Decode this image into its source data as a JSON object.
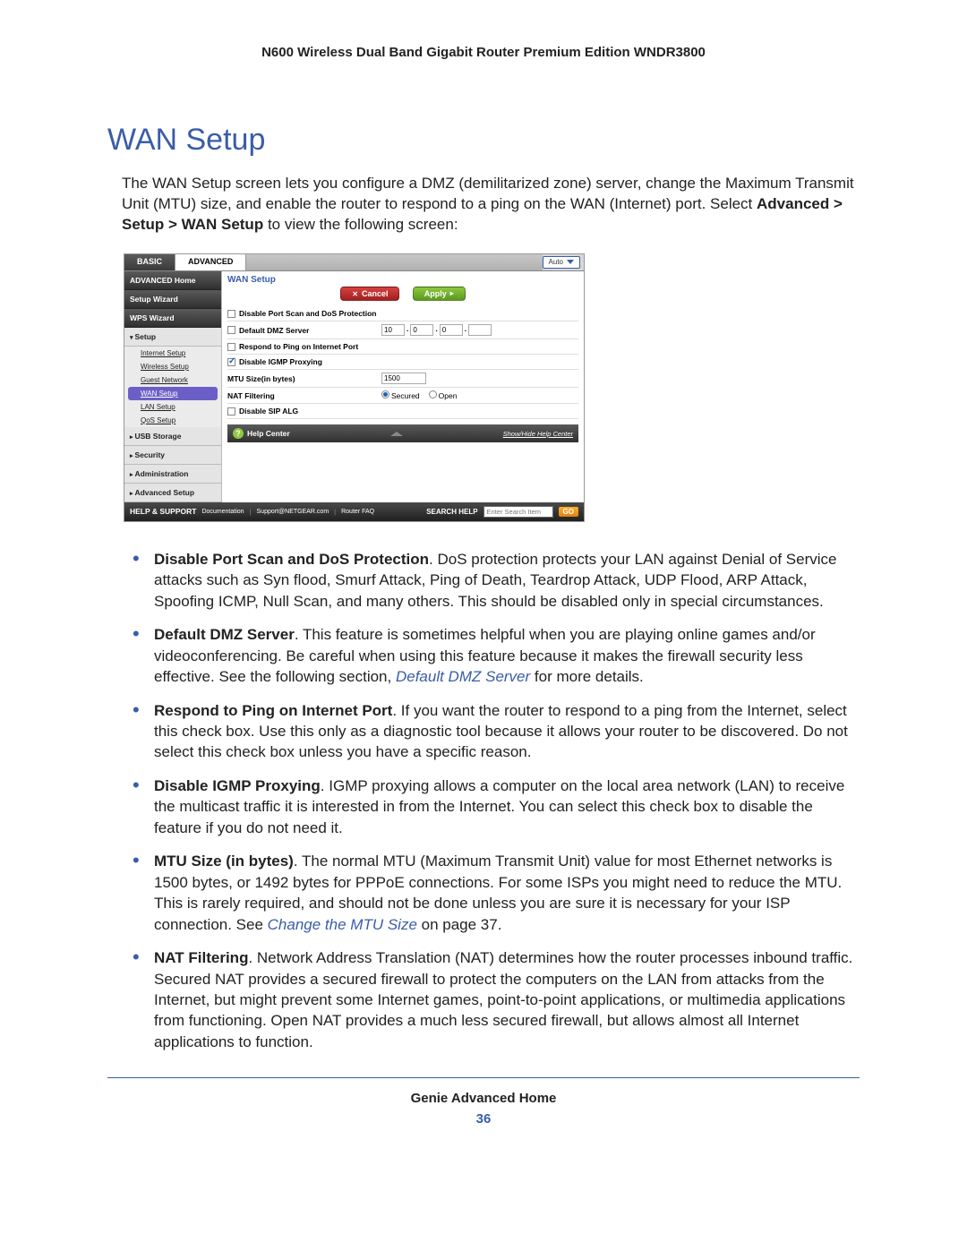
{
  "header": {
    "title": "N600 Wireless Dual Band Gigabit Router Premium Edition WNDR3800"
  },
  "section": {
    "title": "WAN Setup",
    "intro_a": "The WAN Setup screen lets you configure a DMZ (demilitarized zone) server, change the Maximum Transmit Unit (MTU) size, and enable the router to respond to a ping on the WAN (Internet) port. Select ",
    "intro_bold": "Advanced > Setup > WAN Setup",
    "intro_b": " to view the following screen:"
  },
  "shot": {
    "tabs": {
      "basic": "BASIC",
      "advanced": "ADVANCED",
      "auto": "Auto"
    },
    "side": {
      "adv_home": "ADVANCED Home",
      "setup_wiz": "Setup Wizard",
      "wps_wiz": "WPS Wizard",
      "setup": "Setup",
      "internet": "Internet Setup",
      "wireless": "Wireless Setup",
      "guest": "Guest Network",
      "wan": "WAN Setup",
      "lan": "LAN Setup",
      "qos": "QoS Setup",
      "usb": "USB Storage",
      "security": "Security",
      "admin": "Administration",
      "advsetup": "Advanced Setup"
    },
    "panel": {
      "title": "WAN Setup",
      "cancel": "Cancel",
      "apply": "Apply",
      "row1": "Disable Port Scan and DoS Protection",
      "row2": "Default DMZ Server",
      "dmz": [
        "10",
        "0",
        "0",
        ""
      ],
      "row3": "Respond to Ping on Internet Port",
      "row4": "Disable IGMP Proxying",
      "row5": "MTU Size(in bytes)",
      "mtu": "1500",
      "row6": "NAT Filtering",
      "secured": "Secured",
      "open": "Open",
      "row7": "Disable SIP ALG"
    },
    "help": {
      "title": "Help Center",
      "showhide": "Show/Hide Help Center"
    },
    "footer": {
      "hs": "HELP & SUPPORT",
      "doc": "Documentation",
      "sup": "Support@NETGEAR.com",
      "faq": "Router FAQ",
      "search": "SEARCH HELP",
      "placeholder": "Enter Search Item",
      "go": "GO"
    }
  },
  "bullets": [
    {
      "bold": "Disable Port Scan and DoS Protection",
      "text": ". DoS protection protects your LAN against Denial of Service attacks such as Syn flood, Smurf Attack, Ping of Death, Teardrop Attack, UDP Flood, ARP Attack, Spoofing ICMP, Null Scan, and many others. This should be disabled only in special circumstances."
    },
    {
      "bold": "Default DMZ Server",
      "text": ". This feature is sometimes helpful when you are playing online games and/or videoconferencing. Be careful when using this feature because it makes the firewall security less effective. See the following section, ",
      "link": "Default DMZ Server",
      "tail": " for more details."
    },
    {
      "bold": "Respond to Ping on Internet Port",
      "text": ". If you want the router to respond to a ping from the Internet, select this check box. Use this only as a diagnostic tool because it allows your router to be discovered. Do not select this check box unless you have a specific reason."
    },
    {
      "bold": "Disable IGMP Proxying",
      "text": ". IGMP proxying allows a computer on the local area network (LAN) to receive the multicast traffic it is interested in from the Internet. You can select this check box to disable the feature if you do not need it."
    },
    {
      "bold": "MTU Size (in bytes)",
      "text": ". The normal MTU (Maximum Transmit Unit) value for most Ethernet networks is 1500 bytes, or 1492 bytes for PPPoE connections. For some ISPs you might need to reduce the MTU. This is rarely required, and should not be done unless you are sure it is necessary for your ISP connection. See ",
      "link": "Change the MTU Size",
      "tail": " on page 37."
    },
    {
      "bold": "NAT Filtering",
      "text": ". Network Address Translation (NAT) determines how the router processes inbound traffic. Secured NAT provides a secured firewall to protect the computers on the LAN from attacks from the Internet, but might prevent some Internet games, point-to-point applications, or multimedia applications from functioning. Open NAT provides a much less secured firewall, but allows almost all Internet applications to function."
    }
  ],
  "footer": {
    "text": "Genie Advanced Home",
    "page": "36"
  }
}
